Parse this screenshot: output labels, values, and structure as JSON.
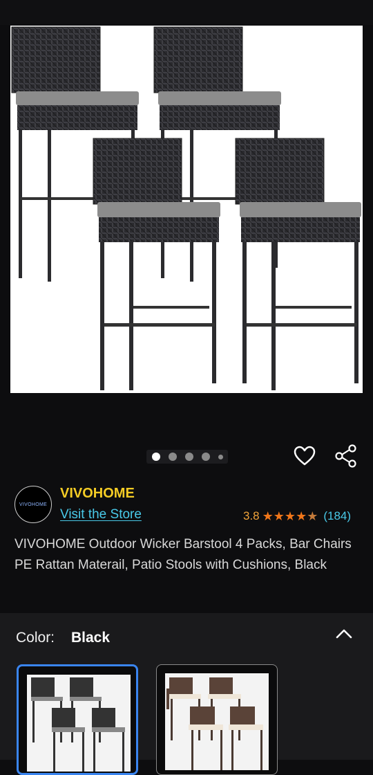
{
  "product": {
    "brand": "VIVOHOME",
    "brand_logo_text": "VIVOHOME",
    "visit_store_label": "Visit the Store",
    "rating": "3.8",
    "rating_count": "(184)",
    "stars_filled": 3.8,
    "title": "VIVOHOME Outdoor Wicker Barstool 4 Packs, Bar Chairs PE Rattan Materail, Patio Stools with Cushions, Black"
  },
  "carousel": {
    "total": 5,
    "active_index": 0
  },
  "options": {
    "color_label": "Color:",
    "color_value": "Black",
    "swatches": [
      {
        "name": "Black",
        "selected": true
      },
      {
        "name": "Brown",
        "selected": false
      }
    ]
  },
  "colors": {
    "background": "#0d0d0f",
    "brand": "#f4cc25",
    "link": "#49c9e8",
    "star": "#f0761a",
    "selected_border": "#3a85f0"
  },
  "icons": [
    "heart-icon",
    "share-icon",
    "chevron-up-icon"
  ]
}
